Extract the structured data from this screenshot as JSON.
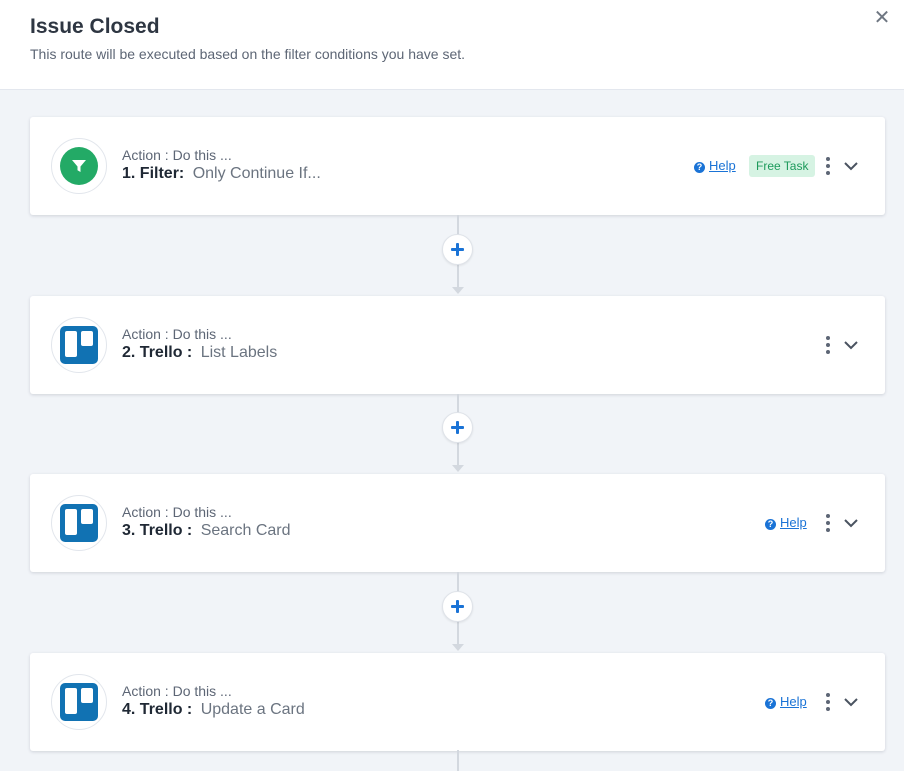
{
  "header": {
    "title": "Issue Closed",
    "subtitle": "This route will be executed based on the filter conditions you have set.",
    "close_icon": "close-icon"
  },
  "steps": [
    {
      "subtitle": "Action : Do this ...",
      "number": "1.",
      "app": "Filter:",
      "action": "Only Continue If...",
      "icon": "filter-icon",
      "help": "Help",
      "badge": "Free Task"
    },
    {
      "subtitle": "Action : Do this ...",
      "number": "2.",
      "app": "Trello :",
      "action": "List Labels",
      "icon": "trello-icon"
    },
    {
      "subtitle": "Action : Do this ...",
      "number": "3.",
      "app": "Trello :",
      "action": "Search Card",
      "icon": "trello-icon",
      "help": "Help"
    },
    {
      "subtitle": "Action : Do this ...",
      "number": "4.",
      "app": "Trello :",
      "action": "Update a Card",
      "icon": "trello-icon",
      "help": "Help"
    }
  ],
  "colors": {
    "accent": "#1a73d6",
    "filter_green": "#23aa66",
    "trello_blue": "#1172b3",
    "badge_bg": "#d6f3e3",
    "badge_text": "#1d9a5b",
    "page_bg": "#f1f4f8"
  }
}
